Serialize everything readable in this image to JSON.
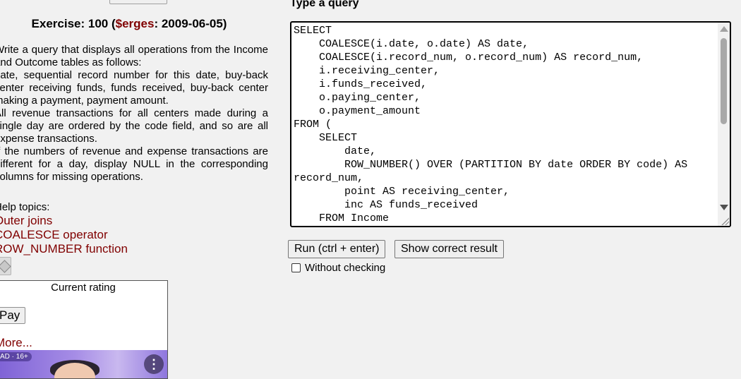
{
  "exercise": {
    "prefix": "Exercise: 100 (",
    "author": "$erges",
    "suffix": ": 2009-06-05)"
  },
  "task": {
    "p1": "Write a query that displays all operations from the Income and Outcome tables as follows:",
    "p2": "date, sequential record number for this date, buy-back center receiving funds, funds received, buy-back center making a payment, payment amount.",
    "p3": "All revenue transactions for all centers made during a single day are ordered by the code field, and so are all expense transactions.",
    "p4": "If the numbers of revenue and expense transactions are different for a day, display NULL in the corresponding columns for missing operations."
  },
  "help": {
    "label": "Help topics:",
    "links": [
      "Outer joins",
      "COALESCE operator",
      "ROW_NUMBER function"
    ]
  },
  "rating": {
    "title": "Current rating",
    "pay_label": "Pay",
    "more_label": "More...",
    "ad_badge": "AD · 16+"
  },
  "editor": {
    "label": "Type a query",
    "code": "SELECT\n    COALESCE(i.date, o.date) AS date,\n    COALESCE(i.record_num, o.record_num) AS record_num,\n    i.receiving_center,\n    i.funds_received,\n    o.paying_center,\n    o.payment_amount\nFROM (\n    SELECT\n        date,\n        ROW_NUMBER() OVER (PARTITION BY date ORDER BY code) AS record_num,\n        point AS receiving_center,\n        inc AS funds_received\n    FROM Income"
  },
  "actions": {
    "run_label": "Run (ctrl + enter)",
    "show_label": "Show correct result",
    "without_checking_label": "Without checking"
  },
  "colors": {
    "link": "#800000",
    "background": "#f1f1f1"
  }
}
